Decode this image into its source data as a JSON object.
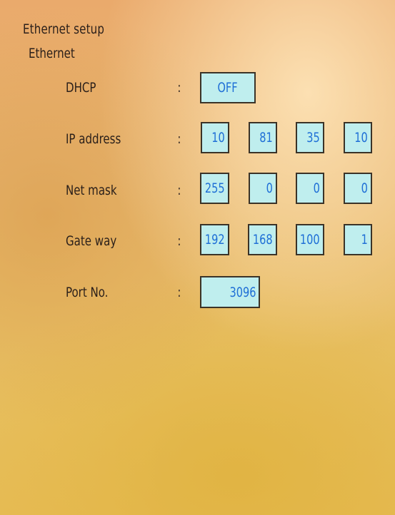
{
  "screen": {
    "title": "Ethernet setup",
    "section": "Ethernet"
  },
  "colon": ":",
  "dhcp": {
    "label": "DHCP",
    "value": "OFF"
  },
  "ip_address": {
    "label": "IP address",
    "octets": [
      "10",
      "81",
      "35",
      "10"
    ]
  },
  "net_mask": {
    "label": "Net mask",
    "octets": [
      "255",
      "0",
      "0",
      "0"
    ]
  },
  "gateway": {
    "label": "Gate way",
    "octets": [
      "192",
      "168",
      "100",
      "1"
    ]
  },
  "port": {
    "label": "Port No.",
    "value": "3096"
  },
  "colors": {
    "field_background": "#bfeeee",
    "field_text": "#1f6fd6",
    "label_text": "#2a1f1a"
  }
}
